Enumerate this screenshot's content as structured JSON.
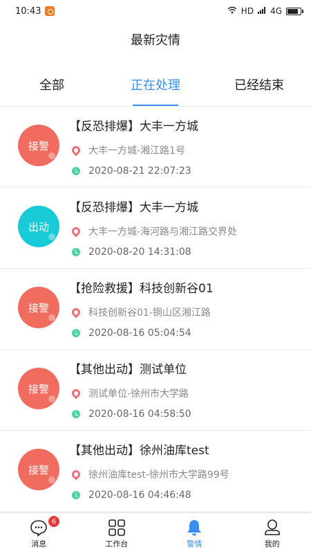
{
  "status_bar": {
    "time": "10:43",
    "network": "HD",
    "signal": "4G",
    "battery_level": 0.85
  },
  "header": {
    "title": "最新灾情"
  },
  "tabs": [
    {
      "label": "全部",
      "active": false
    },
    {
      "label": "正在处理",
      "active": true
    },
    {
      "label": "已经结束",
      "active": false
    }
  ],
  "incidents": [
    {
      "status": "接警",
      "status_color": "#ef6c5f",
      "title": "【反恐排爆】大丰一方城",
      "address": "大丰一方城-湘江路1号",
      "time": "2020-08-21 22:07:23"
    },
    {
      "status": "出动",
      "status_color": "#18c9d6",
      "title": "【反恐排爆】大丰一方城",
      "address": "大丰一方城-海河路与湘江路交界处",
      "time": "2020-08-20 14:31:08"
    },
    {
      "status": "接警",
      "status_color": "#ef6c5f",
      "title": "【抢险救援】科技创新谷01",
      "address": "科技创新谷01-铜山区湘江路",
      "time": "2020-08-16 05:04:54"
    },
    {
      "status": "接警",
      "status_color": "#ef6c5f",
      "title": "【其他出动】测试单位",
      "address": "测试单位-徐州市大学路",
      "time": "2020-08-16 04:58:50"
    },
    {
      "status": "接警",
      "status_color": "#ef6c5f",
      "title": "【其他出动】徐州油库test",
      "address": "徐州油库test-徐州市大学路99号",
      "time": "2020-08-16 04:46:48"
    }
  ],
  "bottom_nav": {
    "items": [
      {
        "label": "消息",
        "icon": "message-icon",
        "badge": "6",
        "active": false
      },
      {
        "label": "工作台",
        "icon": "grid-icon",
        "active": false
      },
      {
        "label": "警情",
        "icon": "bell-icon",
        "active": true
      },
      {
        "label": "我的",
        "icon": "user-icon",
        "active": false
      }
    ]
  },
  "colors": {
    "accent": "#3a8ef0",
    "alert_red": "#ef6c5f",
    "dispatch_cyan": "#18c9d6",
    "pin": "#ec6e7b",
    "clock": "#4fd0a5"
  }
}
